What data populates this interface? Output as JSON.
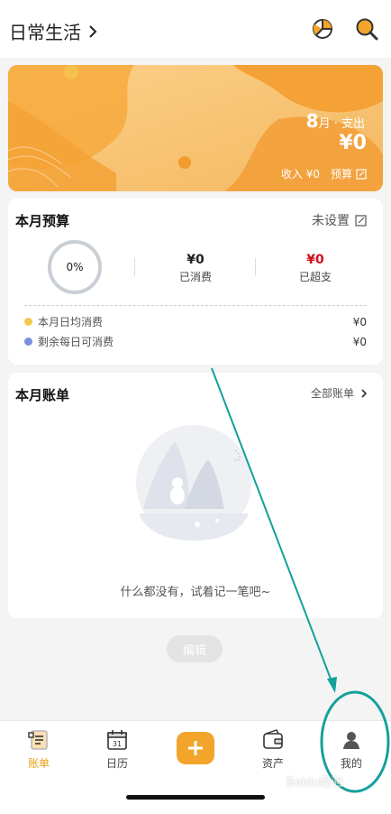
{
  "header": {
    "book_title": "日常生活",
    "icons": [
      "chevron-right-icon",
      "stats-chart-icon",
      "search-icon"
    ]
  },
  "banner": {
    "month_num": "8",
    "month_suffix": "月 · 支出",
    "expense_amount": "¥0",
    "income_label": "收入 ¥0",
    "budget_label": "预算"
  },
  "budget": {
    "title": "本月预算",
    "unset_label": "未设置",
    "progress_text": "0%",
    "spent_value": "¥0",
    "spent_label": "已消费",
    "over_value": "¥0",
    "over_label": "已超支",
    "rows": [
      {
        "label": "本月日均消费",
        "value": "¥0",
        "dot_color": "#f2c94c"
      },
      {
        "label": "剩余每日可消费",
        "value": "¥0",
        "dot_color": "#7b8fe0"
      }
    ]
  },
  "bills": {
    "title": "本月账单",
    "all_label": "全部账单",
    "empty_text": "什么都没有，试着记一笔吧~"
  },
  "edit_label": "编辑",
  "tabs": [
    {
      "label": "账单",
      "icon": "ledger-icon",
      "active": true
    },
    {
      "label": "日历",
      "icon": "calendar-icon",
      "calendar_day": "31"
    },
    {
      "label": "",
      "icon": "plus-icon"
    },
    {
      "label": "资产",
      "icon": "wallet-icon"
    },
    {
      "label": "我的",
      "icon": "profile-icon"
    }
  ],
  "watermark": "Baidu经验",
  "colors": {
    "accent": "#f2a52a",
    "over_red": "#d0101b",
    "annotation": "#14a09b"
  }
}
